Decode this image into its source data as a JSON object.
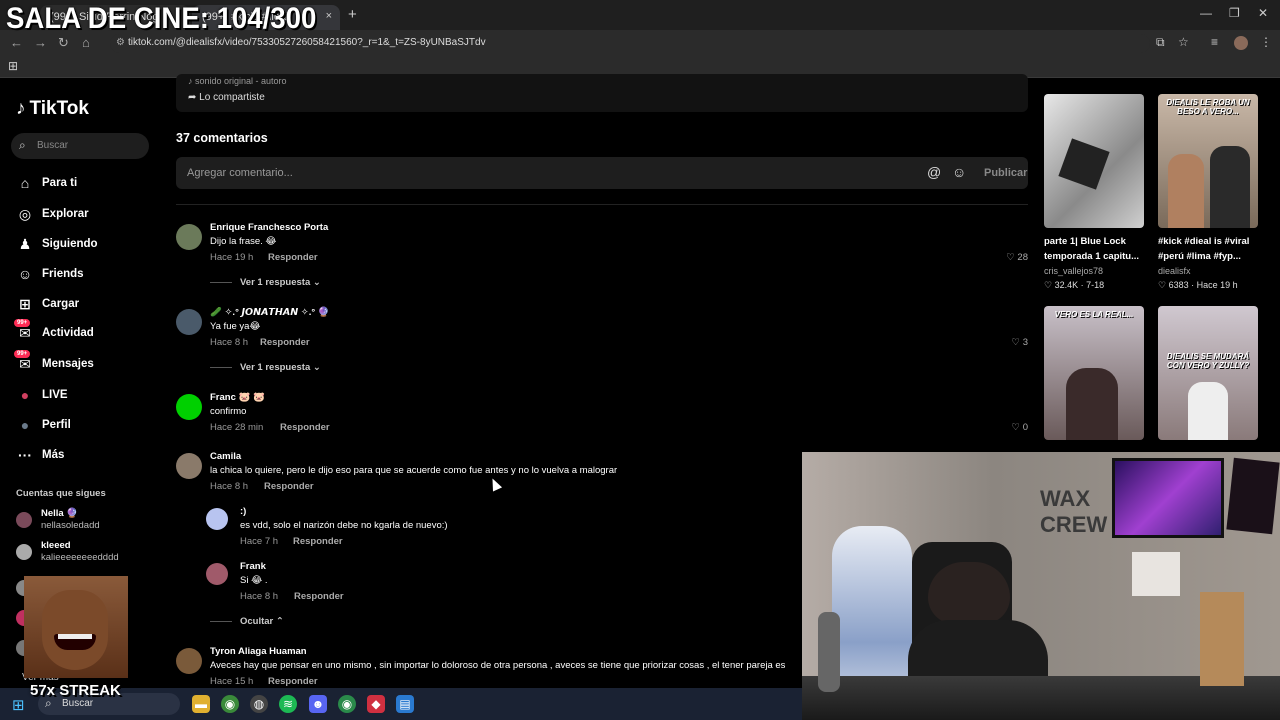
{
  "overlay": {
    "title": "SALA DE CINE: 104/300",
    "streak": "57x STREAK"
  },
  "browser": {
    "tabs": [
      {
        "label": "(99+) Sikid Perrin Nog"
      },
      {
        "label": "(99+) #kick #dieal"
      }
    ],
    "tab_close": "×",
    "new_tab": "+",
    "url": "tiktok.com/@diealisfx/video/7533052726058421560?_r=1&_t=ZS-8yUNBaSJTdv",
    "icons": {
      "back": "back-arrow-icon",
      "forward": "forward-arrow-icon",
      "reload": "reload-icon",
      "home": "home-icon"
    }
  },
  "sidebar": {
    "logo": "TikTok",
    "search_placeholder": "Buscar",
    "nav": [
      {
        "label": "Para ti",
        "icon": "home-icon",
        "glyph": "⌂"
      },
      {
        "label": "Explorar",
        "icon": "compass-icon",
        "glyph": "◎"
      },
      {
        "label": "Siguiendo",
        "icon": "following-icon",
        "glyph": "♟"
      },
      {
        "label": "Friends",
        "icon": "friends-icon",
        "glyph": "☺"
      },
      {
        "label": "Cargar",
        "icon": "upload-icon",
        "glyph": "⊞"
      },
      {
        "label": "Actividad",
        "icon": "activity-icon",
        "glyph": "✉",
        "badge": "99+"
      },
      {
        "label": "Mensajes",
        "icon": "messages-icon",
        "glyph": "✉",
        "badge": "99+"
      },
      {
        "label": "LIVE",
        "icon": "live-icon",
        "glyph": "●"
      },
      {
        "label": "Perfil",
        "icon": "profile-icon",
        "glyph": "●"
      },
      {
        "label": "Más",
        "icon": "more-icon",
        "glyph": "···"
      }
    ],
    "following_heading": "Cuentas que sigues",
    "following": [
      {
        "name": "Nella 🔮",
        "username": "nellasoledadd"
      },
      {
        "name": "kleeed",
        "username": "kalieeeeeeeedddd"
      }
    ],
    "see_more": "Ver más"
  },
  "main": {
    "sound_label": "♪ sonido original - autoro",
    "shared_label": "Lo compartiste",
    "comments_count": "37 comentarios",
    "comment_placeholder": "Agregar comentario...",
    "publish_label": "Publicar",
    "reply_label": "Responder",
    "comments": [
      {
        "name": "Enrique Franchesco Porta",
        "text": "Dijo la frase. 😂",
        "time": "Hace 19 h",
        "likes": "28",
        "avatar_color": "#6b7a5a"
      },
      {
        "name": "🥒 ✧.° 𝙅𝙊𝙉𝘼𝙏𝙃𝘼𝙉 ✧.° 🔮",
        "text": "Ya fue ya😂",
        "time": "Hace 8 h",
        "likes": "3",
        "avatar_color": "#4a5a6a"
      },
      {
        "name": "Franc 🐷 🐷",
        "text": "confirmo",
        "time": "Hace 28 min",
        "likes": "0",
        "avatar_color": "#00d000"
      },
      {
        "name": "Camila",
        "text": "la chica lo quiere, pero le dijo eso para que se acuerde como fue antes y no lo vuelva a malograr",
        "time": "Hace 8 h",
        "likes": "",
        "avatar_color": "#8a7a6a"
      },
      {
        "name": "Tyron Aliaga Huaman",
        "text": "Aveces hay que pensar en uno mismo , sin importar lo doloroso de otra persona , aveces se tiene que priorizar cosas , el tener pareja es",
        "time": "Hace 15 h",
        "likes": "",
        "avatar_color": "#7a5a3a"
      }
    ],
    "replies": [
      {
        "name": ":)",
        "text": "es vdd, solo el narizón debe no kgarla de nuevo:)",
        "time": "Hace 7 h",
        "avatar_color": "#b8c4f0"
      },
      {
        "name": "Frank",
        "text": "Si 😂 .",
        "time": "Hace 8 h",
        "avatar_color": "#a05a6a"
      }
    ],
    "view_replies": "Ver 1 respuesta",
    "hide_label": "Ocultar"
  },
  "rail": {
    "videos": [
      {
        "caption": "parte 1| Blue Lock temporada 1 capitu...",
        "author": "cris_vallejos78",
        "stats": "♡ 32.4K · 7-18",
        "overlay": ""
      },
      {
        "caption": "#kick #dieal is #viral #perú #lima #fyp...",
        "author": "diealisfx",
        "stats": "♡ 6383 · Hace 19 h",
        "overlay": "DIEALIS LE ROBA UN BESO A VERO..."
      },
      {
        "caption": "",
        "author": "",
        "stats": "",
        "overlay": "VERO ES LA REAL..."
      },
      {
        "caption": "",
        "author": "",
        "stats": "",
        "overlay": "DIEALIS SE MUDARÁ CON VERO Y ZULLY?"
      }
    ]
  },
  "webcam": {
    "logo_text": "WAX CREW"
  },
  "taskbar": {
    "search_placeholder": "Buscar"
  }
}
